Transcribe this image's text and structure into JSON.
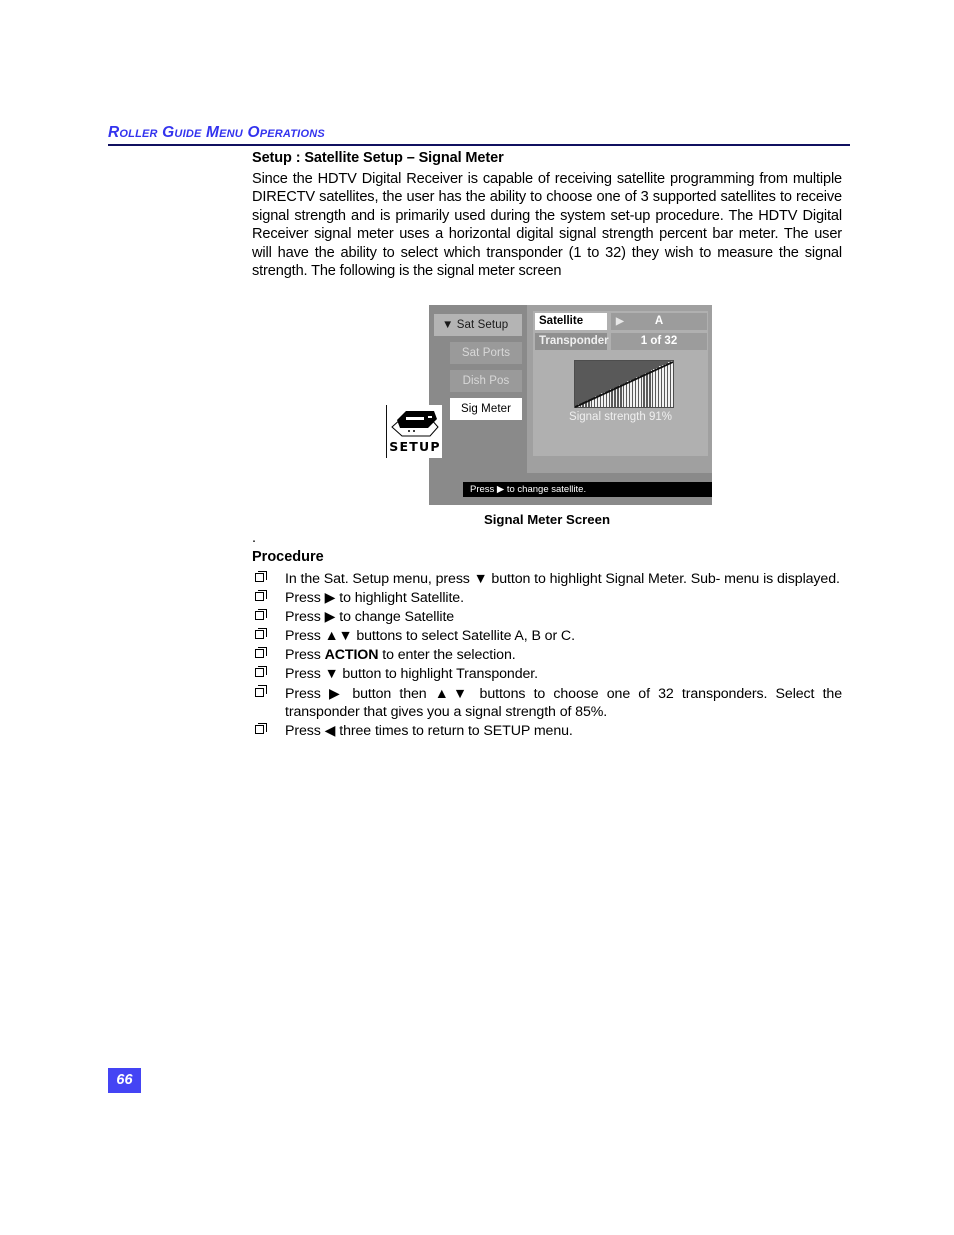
{
  "header": {
    "running_title": "Roller Guide Menu Operations",
    "color": "#3333ee"
  },
  "section": {
    "title": "Setup : Satellite Setup – Signal Meter",
    "paragraph": "Since the HDTV Digital Receiver is capable of receiving satellite programming from multiple DIRECTV satellites, the user has the ability to choose one of 3 supported satellites to receive signal strength and is primarily used during the system set-up procedure. The HDTV Digital Receiver signal meter uses a horizontal digital signal strength percent bar meter. The user will have the ability to select which transponder (1 to 32) they wish to measure the signal strength. The following is the signal meter screen"
  },
  "figure": {
    "caption": "Signal Meter Screen",
    "setup_icon_label": "SETUP",
    "menu": {
      "items": [
        {
          "label": "Sat Setup",
          "state": "expanded",
          "marker": "▼"
        },
        {
          "label": "Sat Ports",
          "state": "dimmed"
        },
        {
          "label": "Dish Pos",
          "state": "dimmed"
        },
        {
          "label": "Sig Meter",
          "state": "selected"
        }
      ]
    },
    "fields": [
      {
        "label": "Satellite",
        "value": "A",
        "arrow": "▶",
        "selected": true
      },
      {
        "label": "Transponder",
        "value": "1 of 32",
        "selected": false
      }
    ],
    "signal": {
      "label": "Signal strength 91%",
      "percent": 91
    },
    "statusbar": "Press ▶ to change satellite."
  },
  "procedure": {
    "stray_dot": ".",
    "title": "Procedure",
    "steps": [
      "In the Sat. Setup menu, press ▼ button to highlight Signal Meter. Sub- menu is displayed.",
      "Press ▶ to highlight Satellite.",
      "Press ▶ to change Satellite",
      "Press ▲▼ buttons to select Satellite A, B or C.",
      "Press ACTION to enter the selection.",
      "Press ▼   button to highlight Transponder.",
      "Press ▶ button then  ▲▼ buttons to choose one of 32 transponders. Select the transponder that gives you a signal strength of 85%.",
      "Press ◀ three times to return to SETUP menu."
    ],
    "bold_term": "ACTION"
  },
  "footer": {
    "page_number": "66"
  }
}
